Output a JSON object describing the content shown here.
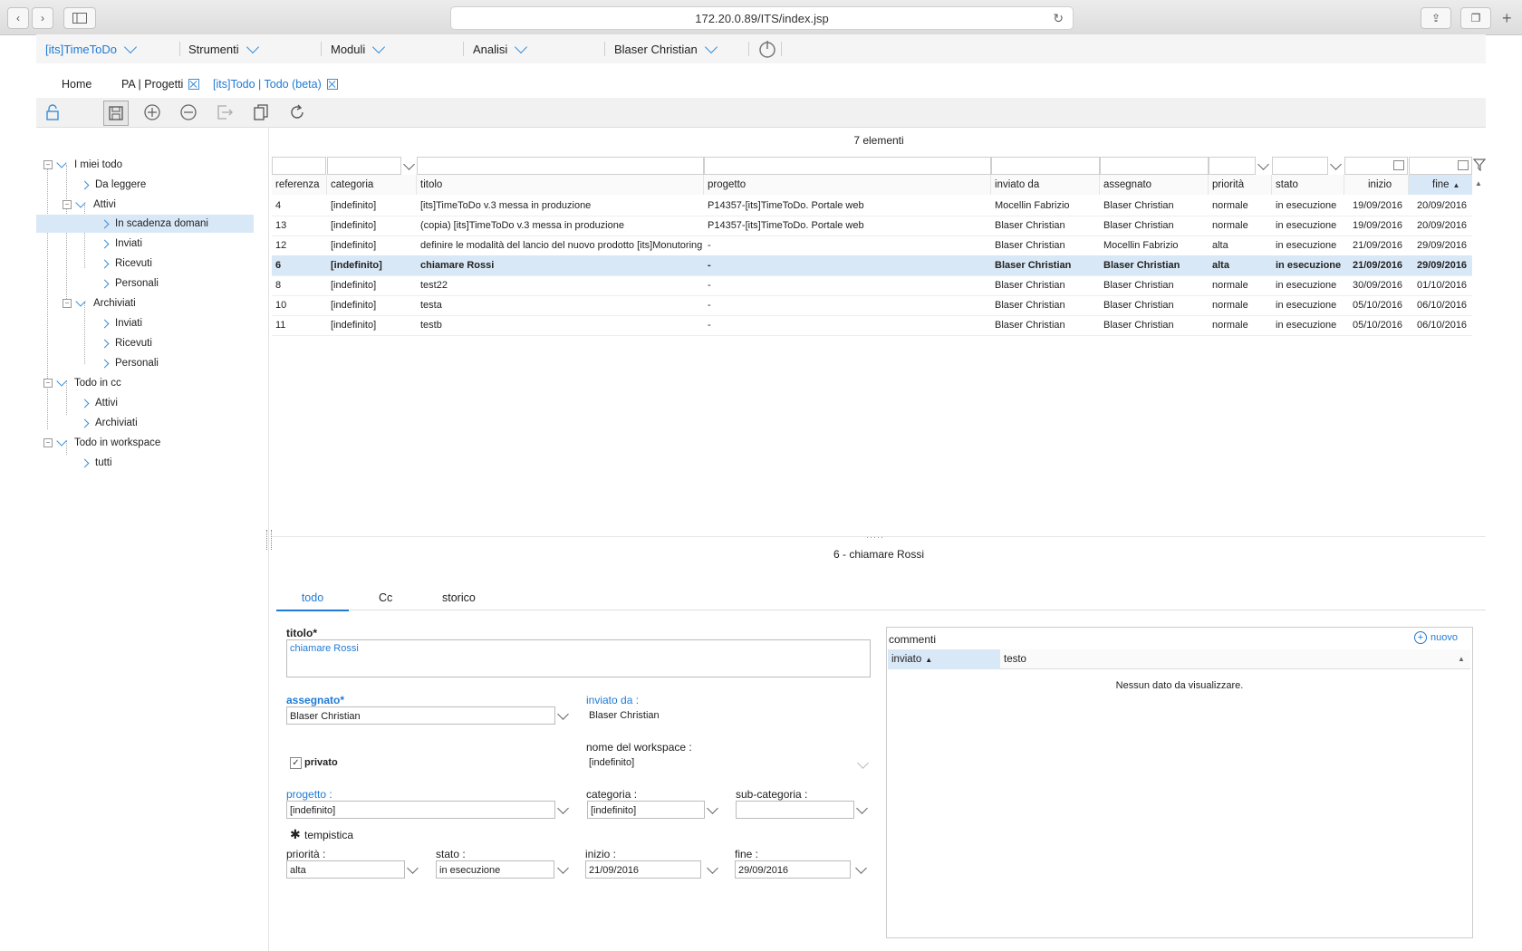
{
  "browser": {
    "url": "172.20.0.89/ITS/index.jsp"
  },
  "menubar": {
    "items": [
      "[its]TimeToDo",
      "Strumenti",
      "Moduli",
      "Analisi",
      "Blaser Christian"
    ]
  },
  "tabs": [
    {
      "label": "Home"
    },
    {
      "label": "PA | Progetti"
    },
    {
      "label": "[its]Todo | Todo (beta)"
    }
  ],
  "tree": {
    "nodes": [
      "I miei todo",
      "Da leggere",
      "Attivi",
      "In scadenza domani",
      "Inviati",
      "Ricevuti",
      "Personali",
      "Archiviati",
      "Inviati",
      "Ricevuti",
      "Personali",
      "Todo in cc",
      "Attivi",
      "Archiviati",
      "Todo in workspace",
      "tutti"
    ]
  },
  "grid": {
    "count_label": "7 elementi",
    "columns": [
      "referenza",
      "categoria",
      "titolo",
      "progetto",
      "inviato da",
      "assegnato",
      "priorità",
      "stato",
      "inizio",
      "fine"
    ],
    "rows": [
      [
        "4",
        "[indefinito]",
        "[its]TimeToDo v.3 messa in produzione",
        "P14357-[its]TimeToDo. Portale web",
        "Mocellin Fabrizio",
        "Blaser Christian",
        "normale",
        "in esecuzione",
        "19/09/2016",
        "20/09/2016"
      ],
      [
        "13",
        "[indefinito]",
        "(copia) [its]TimeToDo v.3 messa in produzione",
        "P14357-[its]TimeToDo. Portale web",
        "Blaser Christian",
        "Blaser Christian",
        "normale",
        "in esecuzione",
        "19/09/2016",
        "20/09/2016"
      ],
      [
        "12",
        "[indefinito]",
        "definire le modalità del lancio del nuovo prodotto [its]Monutoring",
        "-",
        "Blaser Christian",
        "Mocellin Fabrizio",
        "alta",
        "in esecuzione",
        "21/09/2016",
        "29/09/2016"
      ],
      [
        "6",
        "[indefinito]",
        "chiamare Rossi",
        "-",
        "Blaser Christian",
        "Blaser Christian",
        "alta",
        "in esecuzione",
        "21/09/2016",
        "29/09/2016"
      ],
      [
        "8",
        "[indefinito]",
        "test22",
        "-",
        "Blaser Christian",
        "Blaser Christian",
        "normale",
        "in esecuzione",
        "30/09/2016",
        "01/10/2016"
      ],
      [
        "10",
        "[indefinito]",
        "testa",
        "-",
        "Blaser Christian",
        "Blaser Christian",
        "normale",
        "in esecuzione",
        "05/10/2016",
        "06/10/2016"
      ],
      [
        "11",
        "[indefinito]",
        "testb",
        "-",
        "Blaser Christian",
        "Blaser Christian",
        "normale",
        "in esecuzione",
        "05/10/2016",
        "06/10/2016"
      ]
    ]
  },
  "detail": {
    "title": "6 - chiamare Rossi",
    "tabs": [
      "todo",
      "Cc",
      "storico"
    ],
    "titolo_label": "titolo*",
    "titolo_value": "chiamare Rossi",
    "assegnato_label": "assegnato*",
    "assegnato_value": "Blaser Christian",
    "inviato_da_label": "inviato da :",
    "inviato_da_value": "Blaser Christian",
    "privato_label": "privato",
    "workspace_label": "nome del workspace :",
    "workspace_value": "[indefinito]",
    "progetto_label": "progetto :",
    "progetto_value": "[indefinito]",
    "categoria_label": "categoria :",
    "categoria_value": "[indefinito]",
    "subcategoria_label": "sub-categoria :",
    "subcategoria_value": "",
    "tempistica_label": "tempistica",
    "priorita_label": "priorità :",
    "priorita_value": "alta",
    "stato_label": "stato :",
    "stato_value": "in esecuzione",
    "inizio_label": "inizio :",
    "inizio_value": "21/09/2016",
    "fine_label": "fine :",
    "fine_value": "29/09/2016"
  },
  "comments": {
    "title": "commenti",
    "new_label": "nuovo",
    "col_inviato": "inviato",
    "col_testo": "testo",
    "empty": "Nessun dato da visualizzare."
  },
  "colors": {
    "accent": "#1f7ad6",
    "selected_row": "#d9e8f7"
  }
}
